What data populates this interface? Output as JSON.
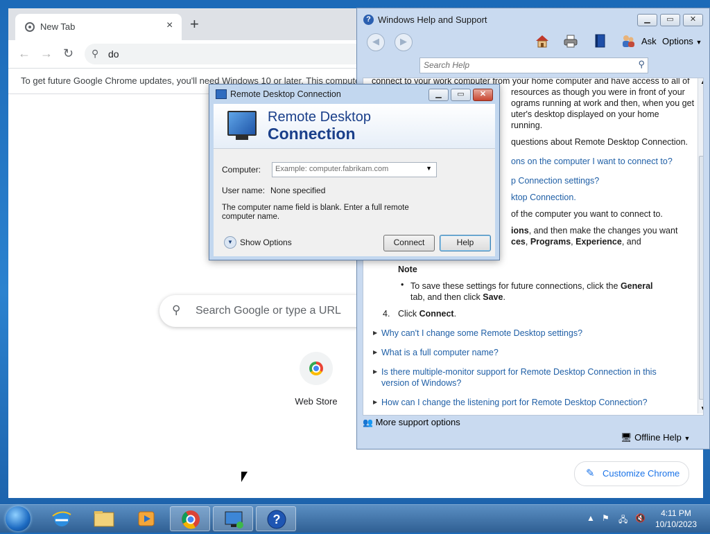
{
  "chrome": {
    "tab_title": "New Tab",
    "tab_close": "×",
    "new_tab": "+",
    "omnibox_text": "do",
    "infobar_text": "To get future Google Chrome updates, you'll need Windows 10 or later. This computer",
    "search_placeholder": "Search Google or type a URL",
    "shortcut_label": "Web Store",
    "customize_label": "Customize Chrome"
  },
  "help": {
    "title": "Windows Help and Support",
    "toolbar": {
      "ask": "Ask",
      "options": "Options"
    },
    "search_placeholder": "Search Help",
    "content": {
      "line1": "connect to your work computer from your home computer and have access to all of",
      "line2": "resources as though you were in front of your",
      "line3": "ograms running at work and then, when you get",
      "line4": "uter's desktop displayed on your home",
      "line5": "running.",
      "line6": "questions about Remote Desktop Connection.",
      "link1": "ons on the computer I want to connect to?",
      "link2": "p Connection settings?",
      "link3": "ktop Connection.",
      "line7": "of the computer you want to connect to.",
      "line8_bold": "ions",
      "line8_rest": ", and then make the changes you want",
      "line9_a": "ces",
      "line9_b": "Programs",
      "line9_c": "Experience",
      "line9_d": ", and",
      "note_label": "Note",
      "bullet_a": "To save these settings for future connections, click the ",
      "bullet_general": "General",
      "bullet_b": "tab, and then click ",
      "bullet_save": "Save",
      "bullet_end": ".",
      "step_num": "4.",
      "step_text": "Click ",
      "step_connect": "Connect",
      "step_end": ".",
      "q1": "Why can't I change some Remote Desktop settings?",
      "q2": "What is a full computer name?",
      "q3a": "Is there multiple-monitor support for Remote Desktop Connection in this",
      "q3b": "version of Windows?",
      "q4": "How can I change the listening port for Remote Desktop Connection?"
    },
    "more_support": "More support options",
    "offline_help": "Offline Help"
  },
  "rdc": {
    "title": "Remote Desktop Connection",
    "heading_line1": "Remote Desktop",
    "heading_line2": "Connection",
    "computer_label": "Computer:",
    "computer_placeholder": "Example: computer.fabrikam.com",
    "username_label": "User name:",
    "username_value": "None specified",
    "message": "The computer name field is blank.  Enter a full remote computer name.",
    "show_options": "Show Options",
    "connect_button": "Connect",
    "help_button": "Help"
  },
  "taskbar": {
    "time": "4:11 PM",
    "date": "10/10/2023"
  },
  "colors": {
    "link": "#1f5fa6",
    "chrome_accent": "#1a73e8",
    "rdc_heading": "#1a3f8a"
  }
}
